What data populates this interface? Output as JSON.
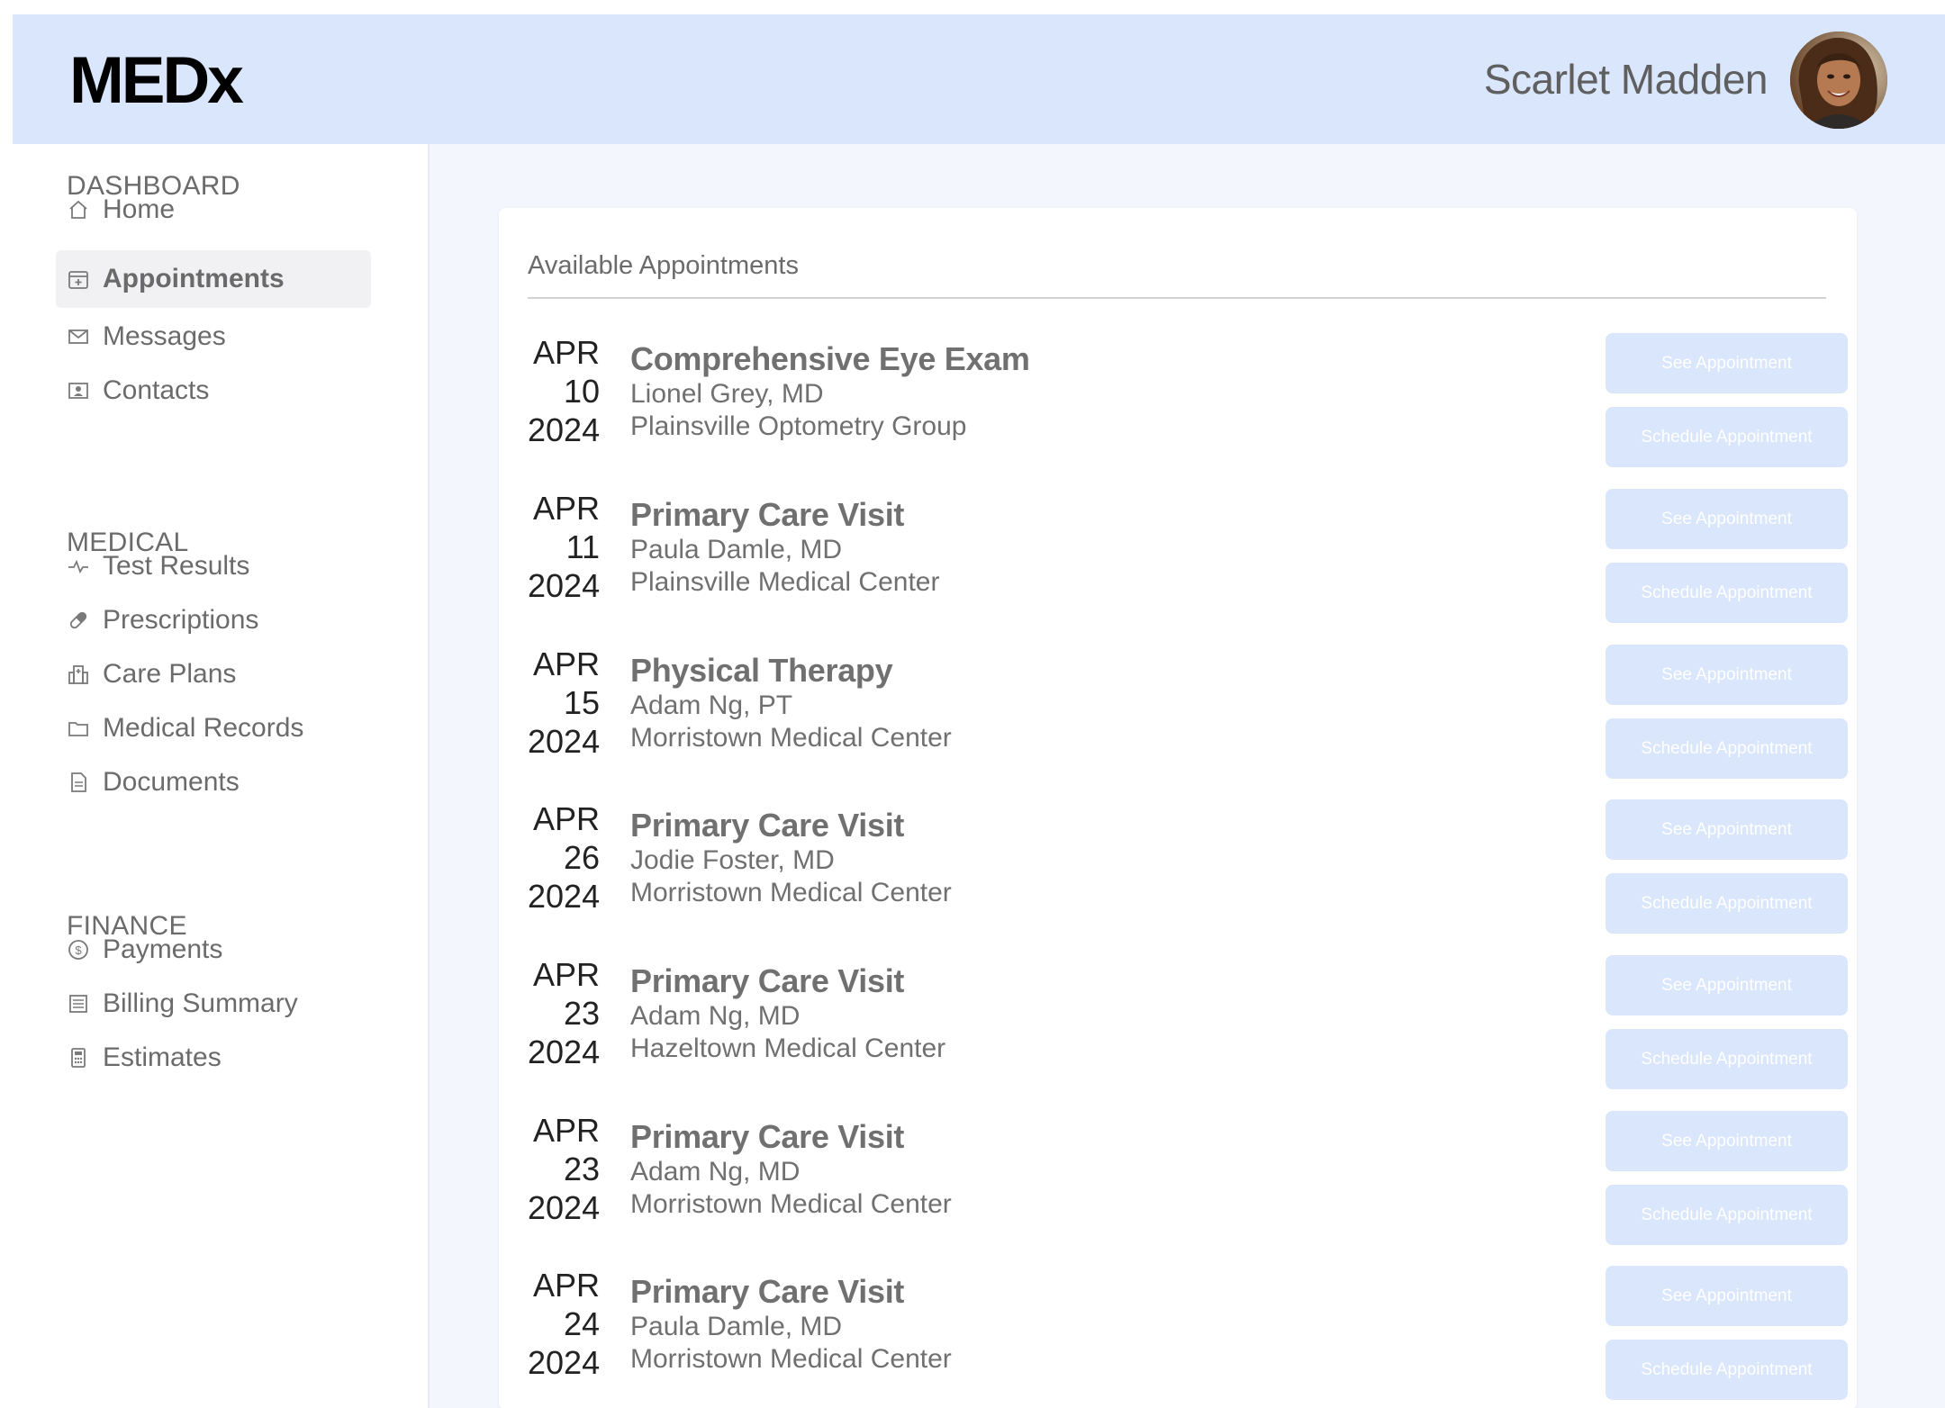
{
  "header": {
    "logo": "MEDx",
    "user_name": "Scarlet Madden"
  },
  "sidebar": {
    "sections": [
      {
        "title": "DASHBOARD",
        "items": [
          {
            "label": "Home",
            "icon": "home-icon"
          },
          {
            "label": "Appointments",
            "icon": "calendar-icon",
            "active": true
          },
          {
            "label": "Messages",
            "icon": "envelope-icon"
          },
          {
            "label": "Contacts",
            "icon": "contact-card-icon"
          }
        ]
      },
      {
        "title": "MEDICAL",
        "items": [
          {
            "label": "Test Results",
            "icon": "pulse-icon"
          },
          {
            "label": "Prescriptions",
            "icon": "pill-icon"
          },
          {
            "label": "Care Plans",
            "icon": "hospital-icon"
          },
          {
            "label": "Medical Records",
            "icon": "folder-icon"
          },
          {
            "label": "Documents",
            "icon": "document-icon"
          }
        ]
      },
      {
        "title": "FINANCE",
        "items": [
          {
            "label": "Payments",
            "icon": "dollar-coin-icon"
          },
          {
            "label": "Billing Summary",
            "icon": "receipt-icon"
          },
          {
            "label": "Estimates",
            "icon": "calculator-icon"
          }
        ]
      }
    ]
  },
  "main": {
    "card_title": "Available Appointments",
    "see_label": "See Appointment",
    "schedule_label": "Schedule Appointment",
    "appointments": [
      {
        "month": "APR",
        "day": "10",
        "year": "2024",
        "title": "Comprehensive Eye Exam",
        "doctor": "Lionel Grey, MD",
        "location": "Plainsville Optometry Group"
      },
      {
        "month": "APR",
        "day": "11",
        "year": "2024",
        "title": "Primary Care Visit",
        "doctor": "Paula Damle, MD",
        "location": "Plainsville Medical Center"
      },
      {
        "month": "APR",
        "day": "15",
        "year": "2024",
        "title": "Physical Therapy",
        "doctor": "Adam Ng, PT",
        "location": "Morristown Medical Center"
      },
      {
        "month": "APR",
        "day": "26",
        "year": "2024",
        "title": "Primary Care Visit",
        "doctor": "Jodie Foster, MD",
        "location": "Morristown Medical Center"
      },
      {
        "month": "APR",
        "day": "23",
        "year": "2024",
        "title": "Primary Care Visit",
        "doctor": "Adam Ng, MD",
        "location": "Hazeltown Medical Center"
      },
      {
        "month": "APR",
        "day": "23",
        "year": "2024",
        "title": "Primary Care Visit",
        "doctor": "Adam Ng, MD",
        "location": "Morristown Medical Center"
      },
      {
        "month": "APR",
        "day": "24",
        "year": "2024",
        "title": "Primary Care Visit",
        "doctor": "Paula Damle, MD",
        "location": "Morristown Medical Center"
      }
    ]
  },
  "colors": {
    "header_bg": "#d9e6fc",
    "button_bg": "#d9e6fc",
    "page_bg": "#f3f7fd",
    "active_nav_bg": "#f1f1f3"
  }
}
